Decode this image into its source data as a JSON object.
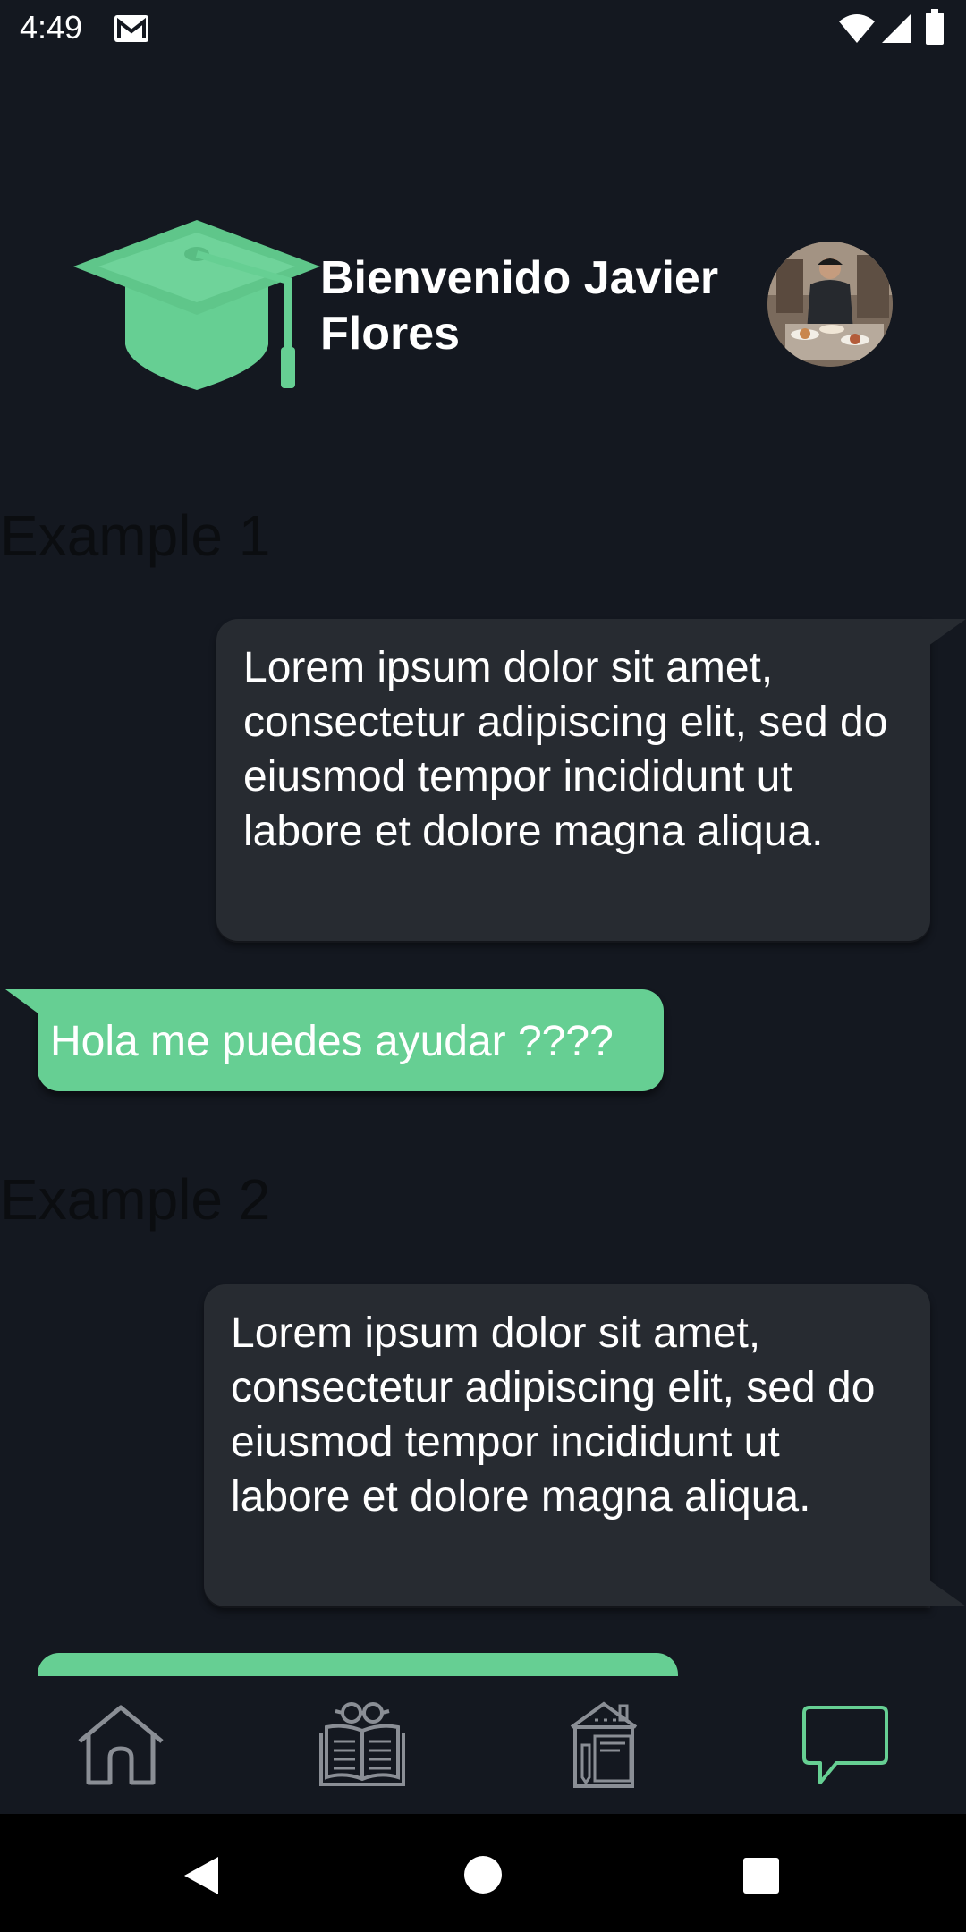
{
  "status_bar": {
    "time": "4:49",
    "icons": [
      "gmail-icon",
      "wifi-icon",
      "signal-icon",
      "battery-icon"
    ]
  },
  "header": {
    "welcome_text": "Bienvenido Javier Flores",
    "logo_icon": "graduation-cap-icon",
    "avatar_icon": "user-avatar-photo"
  },
  "chat": {
    "sections": [
      {
        "label": "Example 1",
        "received_message": "Lorem ipsum dolor sit amet, consectetur adipiscing elit, sed do eiusmod tempor incididunt ut labore et dolore magna aliqua.",
        "sent_message": "Hola me puedes ayudar ????"
      },
      {
        "label": "Example 2",
        "received_message": "Lorem ipsum dolor sit amet, consectetur adipiscing elit, sed do eiusmod tempor incididunt ut labore et dolore magna aliqua."
      }
    ]
  },
  "bottom_nav": {
    "items": [
      {
        "icon": "home-icon",
        "active": false
      },
      {
        "icon": "reading-book-icon",
        "active": false
      },
      {
        "icon": "school-building-icon",
        "active": false
      },
      {
        "icon": "chat-bubble-icon",
        "active": true
      }
    ]
  },
  "system_nav": {
    "icons": [
      "back-icon",
      "home-circle-icon",
      "recents-square-icon"
    ]
  },
  "colors": {
    "background": "#141820",
    "accent": "#66cf93",
    "received_bubble": "#272b31",
    "nav_icon_inactive": "#8a8e95",
    "text": "#ffffff"
  }
}
